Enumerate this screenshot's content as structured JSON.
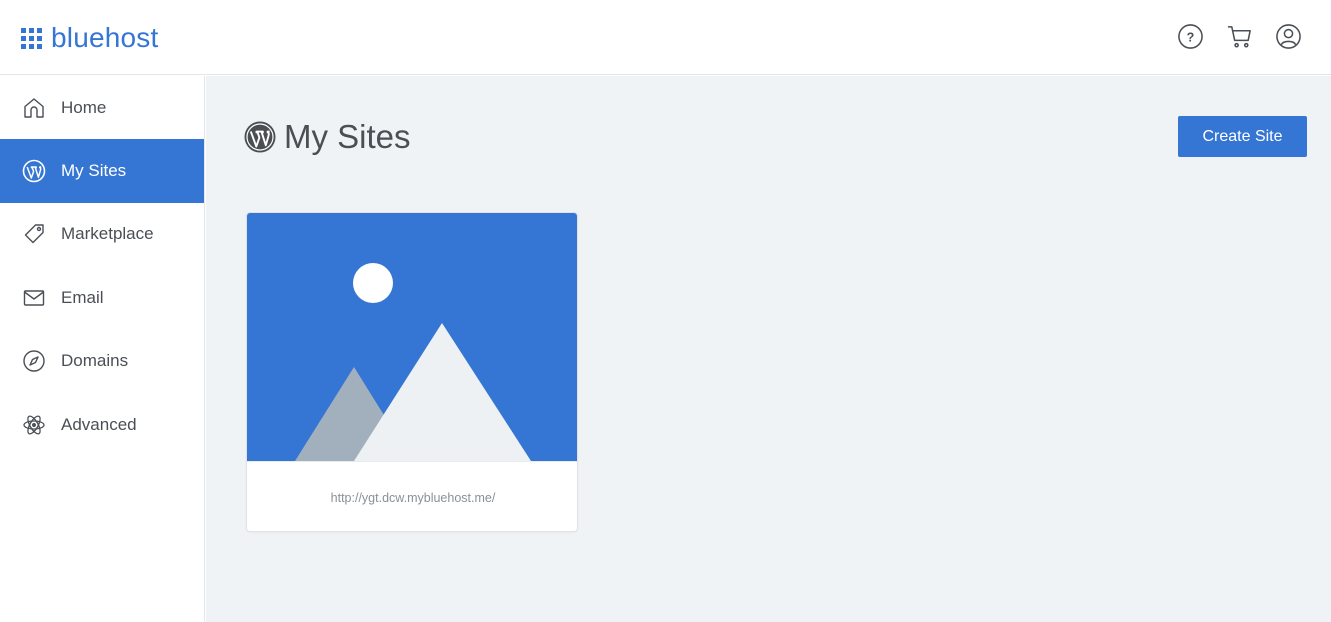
{
  "app": {
    "logo_text": "bluehost",
    "logo_icon": "grid-icon",
    "brand_color": "#3575d3"
  },
  "header": {
    "icons": [
      "help-icon",
      "cart-icon",
      "account-icon"
    ]
  },
  "sidebar": {
    "items": [
      {
        "label": "Home",
        "icon": "home-icon",
        "active": false
      },
      {
        "label": "My Sites",
        "icon": "wordpress-icon",
        "active": true
      },
      {
        "label": "Marketplace",
        "icon": "tag-icon",
        "active": false
      },
      {
        "label": "Email",
        "icon": "mail-icon",
        "active": false
      },
      {
        "label": "Domains",
        "icon": "compass-icon",
        "active": false
      },
      {
        "label": "Advanced",
        "icon": "atom-icon",
        "active": false
      }
    ]
  },
  "main": {
    "title": "My Sites",
    "title_icon": "wordpress-icon",
    "create_button_label": "Create Site",
    "sites": [
      {
        "url": "http://ygt.dcw.mybluehost.me/",
        "thumbnail_icon": "image-placeholder-icon"
      }
    ]
  }
}
